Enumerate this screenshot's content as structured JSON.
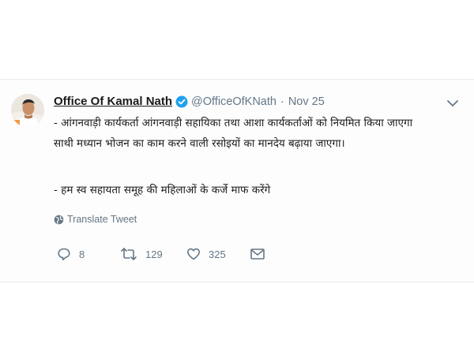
{
  "tweet": {
    "author_name": "Office Of Kamal Nath",
    "handle": "@OfficeOfKNath",
    "separator": "·",
    "time": "Nov 25",
    "text_lines": [
      "- आंगनवाड़ी कार्यकर्ता आंगनवाड़ी सहायिका तथा आशा कार्यकर्ताओं को नियमित किया जाएगा",
      "साथी मध्यान भोजन का काम करने वाली रसोइयों का मानदेय बढ़ाया जाएगा।",
      "- हम स्व सहायता समूह की महिलाओं के कर्जे माफ करेंगे"
    ],
    "translate_label": "Translate Tweet",
    "replies": "8",
    "retweets": "129",
    "likes": "325",
    "icons": {
      "verified": "verified-badge-icon",
      "caret": "chevron-down-icon",
      "translate": "globe-icon",
      "reply": "reply-icon",
      "retweet": "retweet-icon",
      "like": "heart-icon",
      "message": "envelope-icon"
    },
    "colors": {
      "verified": "#1da1f2",
      "meta_text": "#657786",
      "body_text": "#1c1c1c"
    }
  }
}
